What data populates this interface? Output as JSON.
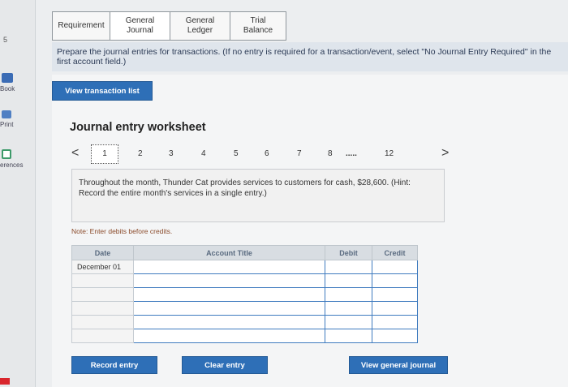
{
  "sidebar": {
    "top_mark": "5",
    "items": [
      {
        "label": "Book",
        "icon": "book-icon"
      },
      {
        "label": "Print",
        "icon": "print-icon"
      },
      {
        "label": "erences",
        "icon": "references-icon"
      }
    ]
  },
  "tabs": [
    {
      "label": "Requirement"
    },
    {
      "label": "General Journal"
    },
    {
      "label": "General Ledger"
    },
    {
      "label": "Trial Balance"
    }
  ],
  "banner": {
    "text": "Prepare the journal entries for transactions.",
    "hint": "(If no entry is required for a transaction/event, select \"No Journal Entry Required\" in the first account field.)"
  },
  "view_transactions_label": "View transaction list",
  "worksheet_title": "Journal entry worksheet",
  "pager": {
    "prev": "<",
    "next": ">",
    "current": "1",
    "pages": [
      "2",
      "3",
      "4",
      "5",
      "6",
      "7",
      "8"
    ],
    "ellipsis": ".....",
    "last": "12"
  },
  "transaction": {
    "text": "Throughout the month, Thunder Cat provides services to customers for cash, $28,600. (Hint: Record the entire month's services in a single entry.)"
  },
  "note": "Note: Enter debits before credits.",
  "table": {
    "headers": {
      "date": "Date",
      "account": "Account Title",
      "debit": "Debit",
      "credit": "Credit"
    },
    "rows": [
      {
        "date": "December 01"
      },
      {
        "date": ""
      },
      {
        "date": ""
      },
      {
        "date": ""
      },
      {
        "date": ""
      },
      {
        "date": ""
      }
    ]
  },
  "buttons": {
    "record": "Record entry",
    "clear": "Clear entry",
    "view_journal": "View general journal"
  },
  "colors": {
    "accent": "#2e6fb7",
    "banner": "#dfe5ec",
    "input_border": "#3f7bbf"
  }
}
